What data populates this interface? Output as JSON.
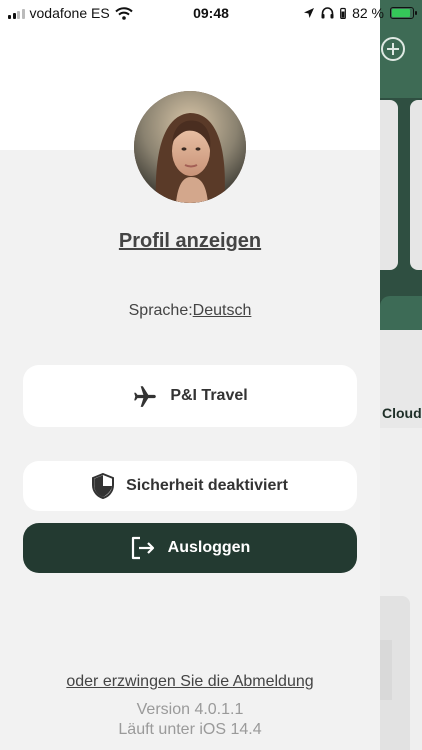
{
  "status_bar": {
    "carrier": "vodafone ES",
    "time": "09:48",
    "battery": "82 %",
    "battery_level": 0.82
  },
  "drawer": {
    "profile_link": "Profil anzeigen",
    "language_label": "Sprache:",
    "language_value": "Deutsch",
    "travel_button": "P&I Travel",
    "security_button": "Sicherheit deaktiviert",
    "logout_button": "Ausloggen",
    "force_logout_link": "oder erzwingen Sie die Abmeldung",
    "version": "Version 4.0.1.1",
    "platform": "Läuft unter iOS 14.4"
  },
  "background": {
    "cloud_label": "Cloud"
  },
  "colors": {
    "dark_green": "#233a31",
    "accent_green": "#3d6b56",
    "panel": "#f2f2f2"
  }
}
